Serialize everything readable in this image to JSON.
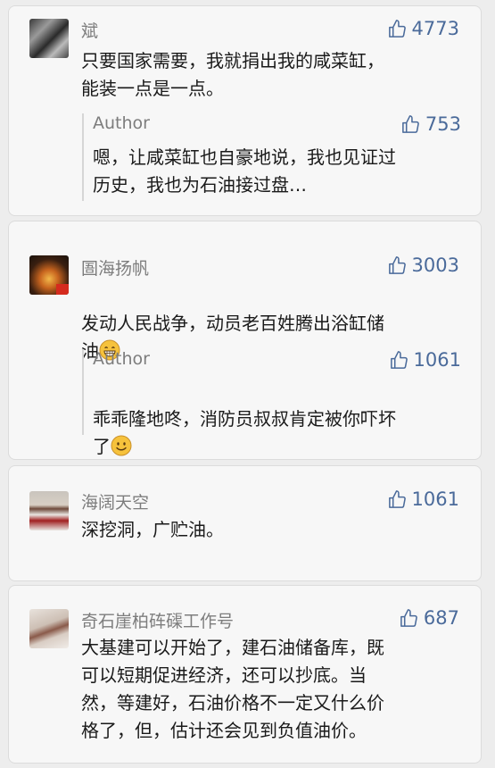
{
  "comments": [
    {
      "name": "斌",
      "likes": "4773",
      "text": "只要国家需要，我就捐出我的咸菜缸，\n能装一点是一点。",
      "reply": {
        "name": "Author",
        "likes": "753",
        "text": "嗯，让咸菜缸也自豪地说，我也见证过\n历史，我也为石油接过盘…"
      }
    },
    {
      "name": "圄海扬帆",
      "likes": "3003",
      "text": "发动人民战争，动员老百姓腾出浴缸储\n油",
      "reply": {
        "name": "Author",
        "likes": "1061",
        "text": "乖乖隆地咚，消防员叔叔肯定被你吓坏\n了"
      }
    },
    {
      "name": "海阔天空",
      "likes": "1061",
      "text": "深挖洞，广贮油。"
    },
    {
      "name": "奇石崖柏砗磲工作号",
      "likes": "687",
      "text": "大基建可以开始了，建石油储备库，既\n可以短期促进经济，还可以抄底。当\n然，等建好，石油价格不一定又什么价\n格了，但，估计还会见到负值油价。"
    }
  ],
  "icons": {
    "like": "thumbs-up-icon",
    "emoji_grin": "grinning-face-icon",
    "emoji_smile": "smiling-face-icon"
  },
  "colors": {
    "like_blue": "#4a6a9a",
    "name_gray": "#7d7d7d",
    "card_bg": "#f7f7f7"
  }
}
